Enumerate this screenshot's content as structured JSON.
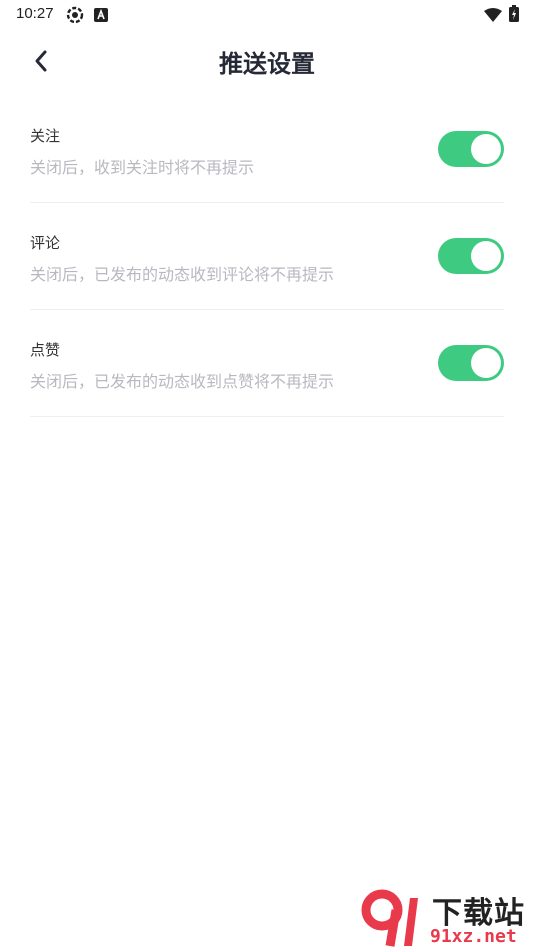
{
  "status_bar": {
    "time": "10:27",
    "icons": [
      "settings-gear-icon",
      "a-badge-icon",
      "wifi-icon",
      "battery-charging-icon"
    ]
  },
  "header": {
    "back_icon": "chevron-left-icon",
    "title": "推送设置"
  },
  "settings": [
    {
      "title": "关注",
      "description": "关闭后，收到关注时将不再提示",
      "enabled": true
    },
    {
      "title": "评论",
      "description": "关闭后，已发布的动态收到评论将不再提示",
      "enabled": true
    },
    {
      "title": "点赞",
      "description": "关闭后，已发布的动态收到点赞将不再提示",
      "enabled": true
    }
  ],
  "watermark": {
    "logo_text": "下载站",
    "site": "91xz.net"
  },
  "colors": {
    "toggle_on": "#3ecb81",
    "title": "#262a36",
    "description": "#b8b8c0",
    "divider": "#eeeeee",
    "watermark_red": "#e83a4b"
  }
}
